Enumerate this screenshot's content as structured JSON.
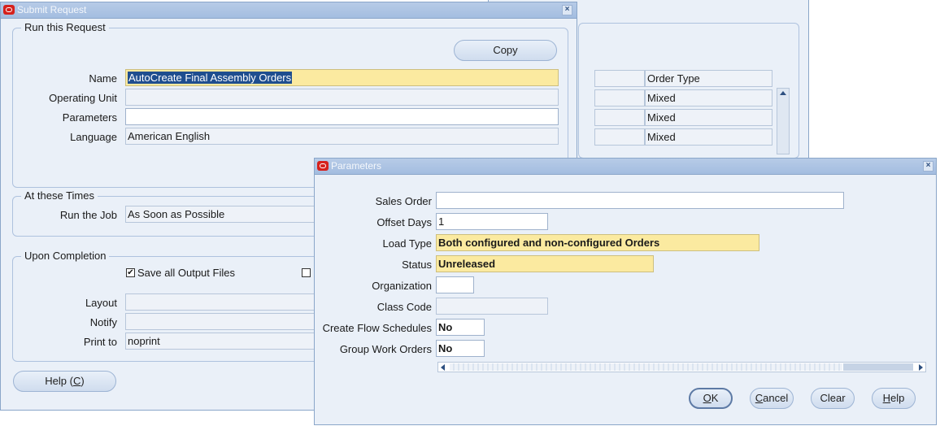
{
  "background_window": {
    "columns": [
      "",
      "Order Type"
    ],
    "rows": [
      {
        "order_type": "Mixed"
      },
      {
        "order_type": "Mixed"
      },
      {
        "order_type": "Mixed"
      }
    ]
  },
  "submit_request": {
    "title": "Submit Request",
    "run_group": {
      "label": "Run this Request",
      "copy_button": "Copy",
      "name_label": "Name",
      "name_value": "AutoCreate Final Assembly Orders",
      "operating_unit_label": "Operating Unit",
      "operating_unit_value": "",
      "parameters_label": "Parameters",
      "parameters_value": "",
      "language_label": "Language",
      "language_value": "American English"
    },
    "times_group": {
      "label": "At these Times",
      "run_job_label": "Run the Job",
      "run_job_value": "As Soon as Possible"
    },
    "completion_group": {
      "label": "Upon Completion",
      "save_output_label": "Save all Output Files",
      "save_output_checked": true,
      "layout_label": "Layout",
      "layout_value": "",
      "notify_label": "Notify",
      "notify_value": "",
      "print_to_label": "Print to",
      "print_to_value": "noprint"
    },
    "help_button_text": "Help (",
    "help_button_mnemonic": "C",
    "help_button_close": ")"
  },
  "parameters": {
    "title": "Parameters",
    "fields": {
      "sales_order_label": "Sales Order",
      "sales_order_value": "",
      "offset_days_label": "Offset Days",
      "offset_days_value": "1",
      "load_type_label": "Load Type",
      "load_type_value": "Both configured and non-configured Orders",
      "status_label": "Status",
      "status_value": "Unreleased",
      "organization_label": "Organization",
      "organization_value": "",
      "class_code_label": "Class Code",
      "class_code_value": "",
      "flow_schedules_label": "Create Flow Schedules",
      "flow_schedules_value": "No",
      "group_work_orders_label": "Group Work Orders",
      "group_work_orders_value": "No"
    },
    "buttons": {
      "ok_mnemonic": "O",
      "ok_rest": "K",
      "cancel_mnemonic": "C",
      "cancel_rest": "ancel",
      "clear": "Clear",
      "help_mnemonic": "H",
      "help_rest": "elp"
    }
  },
  "colors": {
    "required_field": "#fbeaa0",
    "window_bg": "#eaf0f8",
    "title_bar": "#a3bde0",
    "oracle_icon": "#d6211c"
  },
  "icons": [
    "oracle-window-icon",
    "close-icon",
    "scroll-up-icon",
    "scroll-left-icon",
    "scroll-right-icon",
    "checkbox-checked-icon"
  ]
}
